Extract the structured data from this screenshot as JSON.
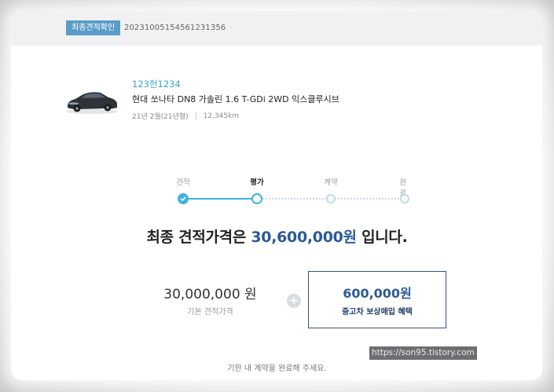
{
  "header": {
    "tag_label": "최종견적확인",
    "quote_id": "20231005154561231356"
  },
  "vehicle": {
    "plate": "123헌1234",
    "model": "현대 쏘나타 DN8 가솔린 1.6 T-GDi 2WD 익스클루시브",
    "registered": "21년 2월(21년형)",
    "mileage": "12,345km",
    "image_icon": "car-photo"
  },
  "stepper": {
    "steps": [
      {
        "label": "견적",
        "state": "done"
      },
      {
        "label": "평가",
        "state": "current"
      },
      {
        "label": "계약",
        "state": "todo"
      },
      {
        "label": "완료",
        "state": "todo"
      }
    ],
    "active_color": "#3eb1df"
  },
  "headline": {
    "prefix": "최종 견적가격은 ",
    "price": "30,600,000원",
    "suffix": " 입니다."
  },
  "breakdown": {
    "base_price": "30,000,000 원",
    "base_label": "기본 견적가격",
    "plus_icon": "plus-icon",
    "bonus_price": "600,000원",
    "bonus_label": "중고차 보상매입 혜택"
  },
  "watermark": "https://son95.tistory.com",
  "footer_notice": "기한 내 계약을 완료해 주세요.",
  "colors": {
    "accent_blue": "#3eb1df",
    "price_navy": "#2b5b96",
    "tag_bg": "#5a9cc7"
  }
}
